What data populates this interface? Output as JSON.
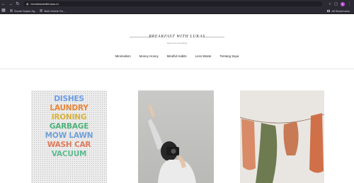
{
  "browser": {
    "url": "breakfastwithlukas.id",
    "profile_initial": "L",
    "bookmarks": [
      "Social Sejam Ag...",
      "Bulk Delete Su..."
    ],
    "all_bookmarks": "All Bookmarks"
  },
  "site": {
    "brand": "BREAKFAST WITH LUKAS",
    "tagline": "learn from everything",
    "menu": [
      "Minimalism",
      "Money Honey",
      "Mindful Habits",
      "Less Waste",
      "Tentang Saya"
    ]
  },
  "cards": [
    {
      "lines": [
        "DISHES",
        "LAUNDRY",
        "IRONING",
        "GARBAGE",
        "MOW LAWN",
        "WASH CAR",
        "VACUUM"
      ]
    },
    {
      "name": "woman-camera-photo"
    },
    {
      "name": "hanging-cloths-photo"
    }
  ],
  "colors": {
    "browser_dark": "#2b2a33",
    "accent": "#c54fe0"
  }
}
